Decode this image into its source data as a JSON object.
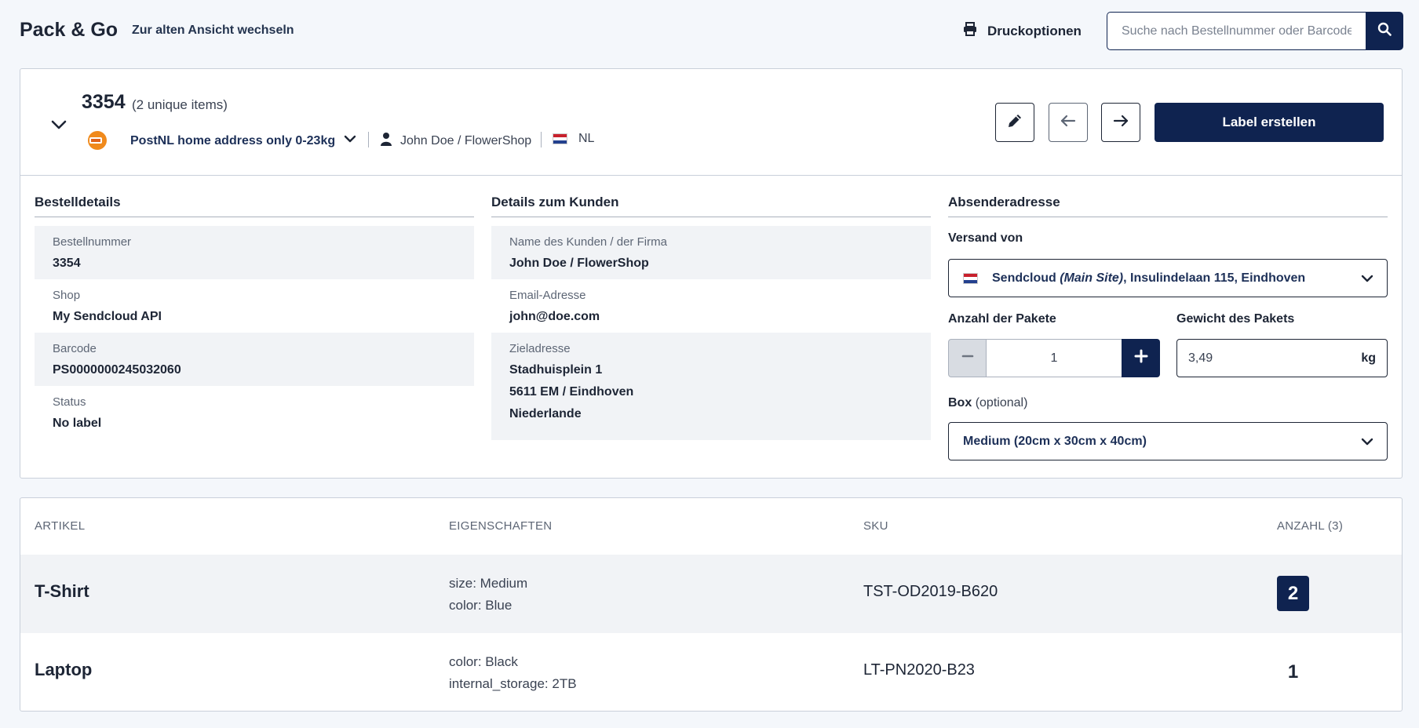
{
  "header": {
    "app_title": "Pack & Go",
    "old_view_link": "Zur alten Ansicht wechseln",
    "print_options": "Druckoptionen",
    "search_placeholder": "Suche nach Bestellnummer oder Barcode"
  },
  "order": {
    "number": "3354",
    "unique_items": "(2 unique items)",
    "shipping_method": "PostNL home address only 0-23kg",
    "customer": "John Doe / FlowerShop",
    "country_code": "NL",
    "create_label_button": "Label erstellen"
  },
  "order_details": {
    "title": "Bestelldetails",
    "rows": [
      {
        "label": "Bestellnummer",
        "value": "3354"
      },
      {
        "label": "Shop",
        "value": "My Sendcloud API"
      },
      {
        "label": "Barcode",
        "value": "PS0000000245032060"
      },
      {
        "label": "Status",
        "value": "No label"
      }
    ]
  },
  "customer_details": {
    "title": "Details zum Kunden",
    "name_label": "Name des Kunden / der Firma",
    "name_value": "John Doe / FlowerShop",
    "email_label": "Email-Adresse",
    "email_value": "john@doe.com",
    "address_label": "Zieladresse",
    "address_line1": "Stadhuisplein 1",
    "address_line2": "5611 EM / Eindhoven",
    "address_line3": "Niederlande"
  },
  "sender": {
    "title": "Absenderadresse",
    "ship_from_label": "Versand von",
    "ship_from_company": "Sendcloud",
    "ship_from_site": "(Main Site)",
    "ship_from_address": ", Insulindelaan 115, Eindhoven",
    "packages_label": "Anzahl der Pakete",
    "packages_value": "1",
    "weight_label": "Gewicht des Pakets",
    "weight_value": "3,49",
    "weight_unit": "kg",
    "box_label": "Box",
    "box_optional": "(optional)",
    "box_value": "Medium (20cm x 30cm x 40cm)"
  },
  "items_table": {
    "columns": [
      "ARTIKEL",
      "EIGENSCHAFTEN",
      "SKU",
      "ANZAHL (3)"
    ],
    "rows": [
      {
        "name": "T-Shirt",
        "props": [
          "size: Medium",
          "color: Blue"
        ],
        "sku": "TST-OD2019-B620",
        "qty": "2"
      },
      {
        "name": "Laptop",
        "props": [
          "color: Black",
          "internal_storage: 2TB"
        ],
        "sku": "LT-PN2020-B23",
        "qty": "1"
      }
    ]
  },
  "colors": {
    "primary": "#0f2350",
    "background": "#f4f7fb",
    "row_shade": "#f1f3f6",
    "postnl_orange": "#f08a1c"
  },
  "icons": [
    "printer-icon",
    "search-icon",
    "chevron-down-icon",
    "postnl-logo",
    "user-icon",
    "nl-flag-icon",
    "pencil-icon",
    "arrow-left-icon",
    "arrow-right-icon",
    "minus-icon",
    "plus-icon"
  ]
}
